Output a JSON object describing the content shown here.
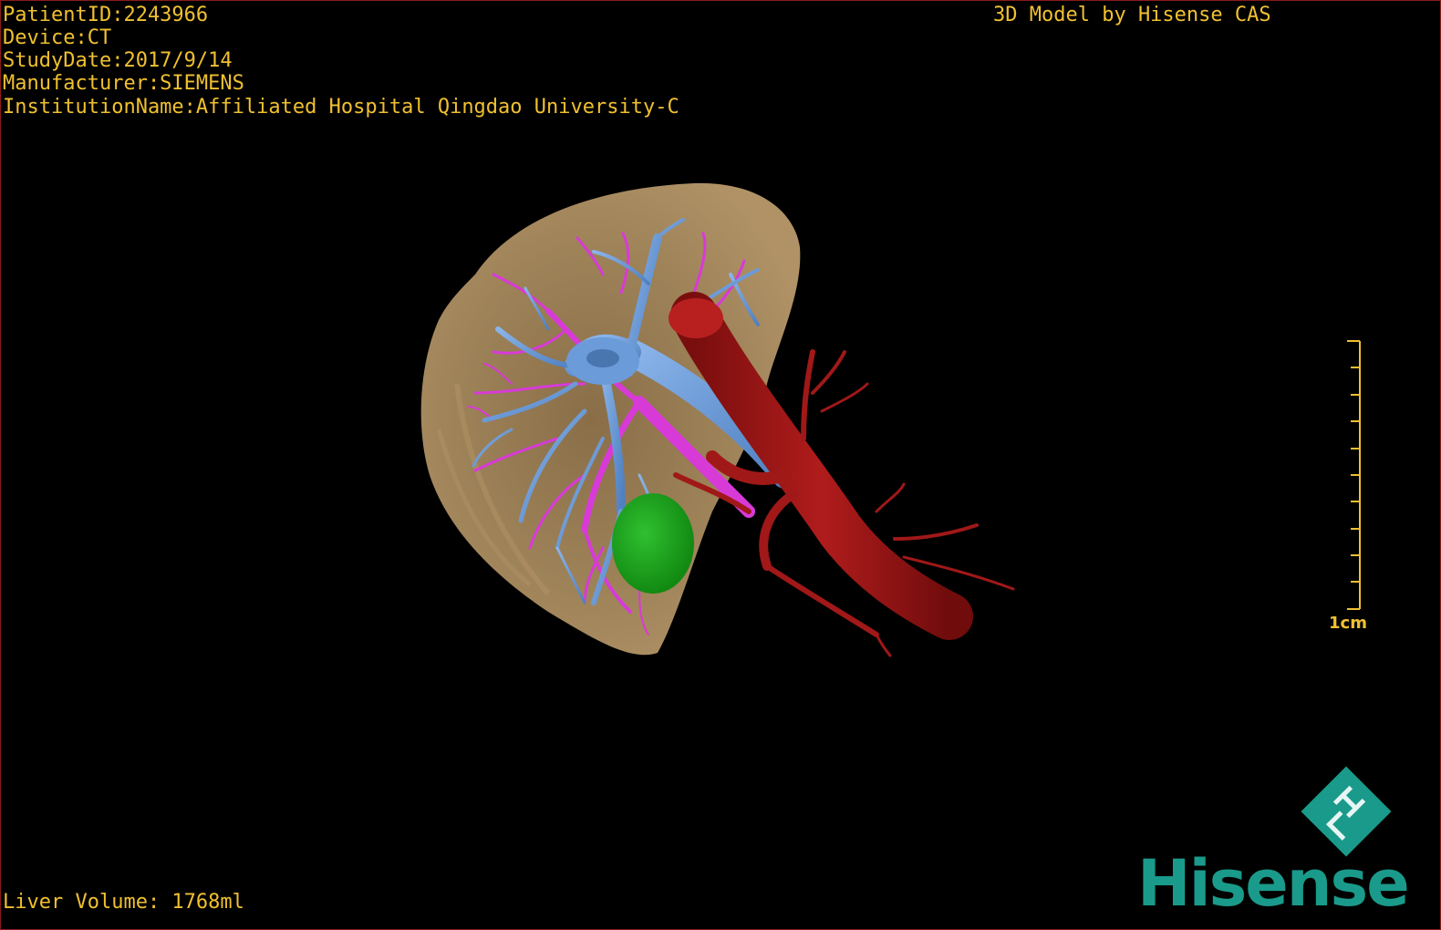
{
  "dicom_info": {
    "patient_id": "PatientID:2243966",
    "device": "Device:CT",
    "study_date": "StudyDate:2017/9/14",
    "manufacturer": "Manufacturer:SIEMENS",
    "institution": "InstitutionName:Affiliated Hospital Qingdao University-C"
  },
  "credit": "3D Model by Hisense CAS",
  "liver_volume": "Liver Volume: 1768ml",
  "scale_bar": {
    "label": "1cm"
  },
  "brand": {
    "name": "Hisense"
  },
  "colors": {
    "text": "#f0c030",
    "liver": "#a0845a",
    "portal_vein": "#6b9bd8",
    "hepatic_vein": "#d83ad8",
    "artery": "#a01818",
    "tumor": "#1fa01f",
    "brand": "#1a9a8a"
  },
  "icons": [
    "liver-3d-model",
    "scale-bar-icon",
    "hisense-logo-icon"
  ]
}
